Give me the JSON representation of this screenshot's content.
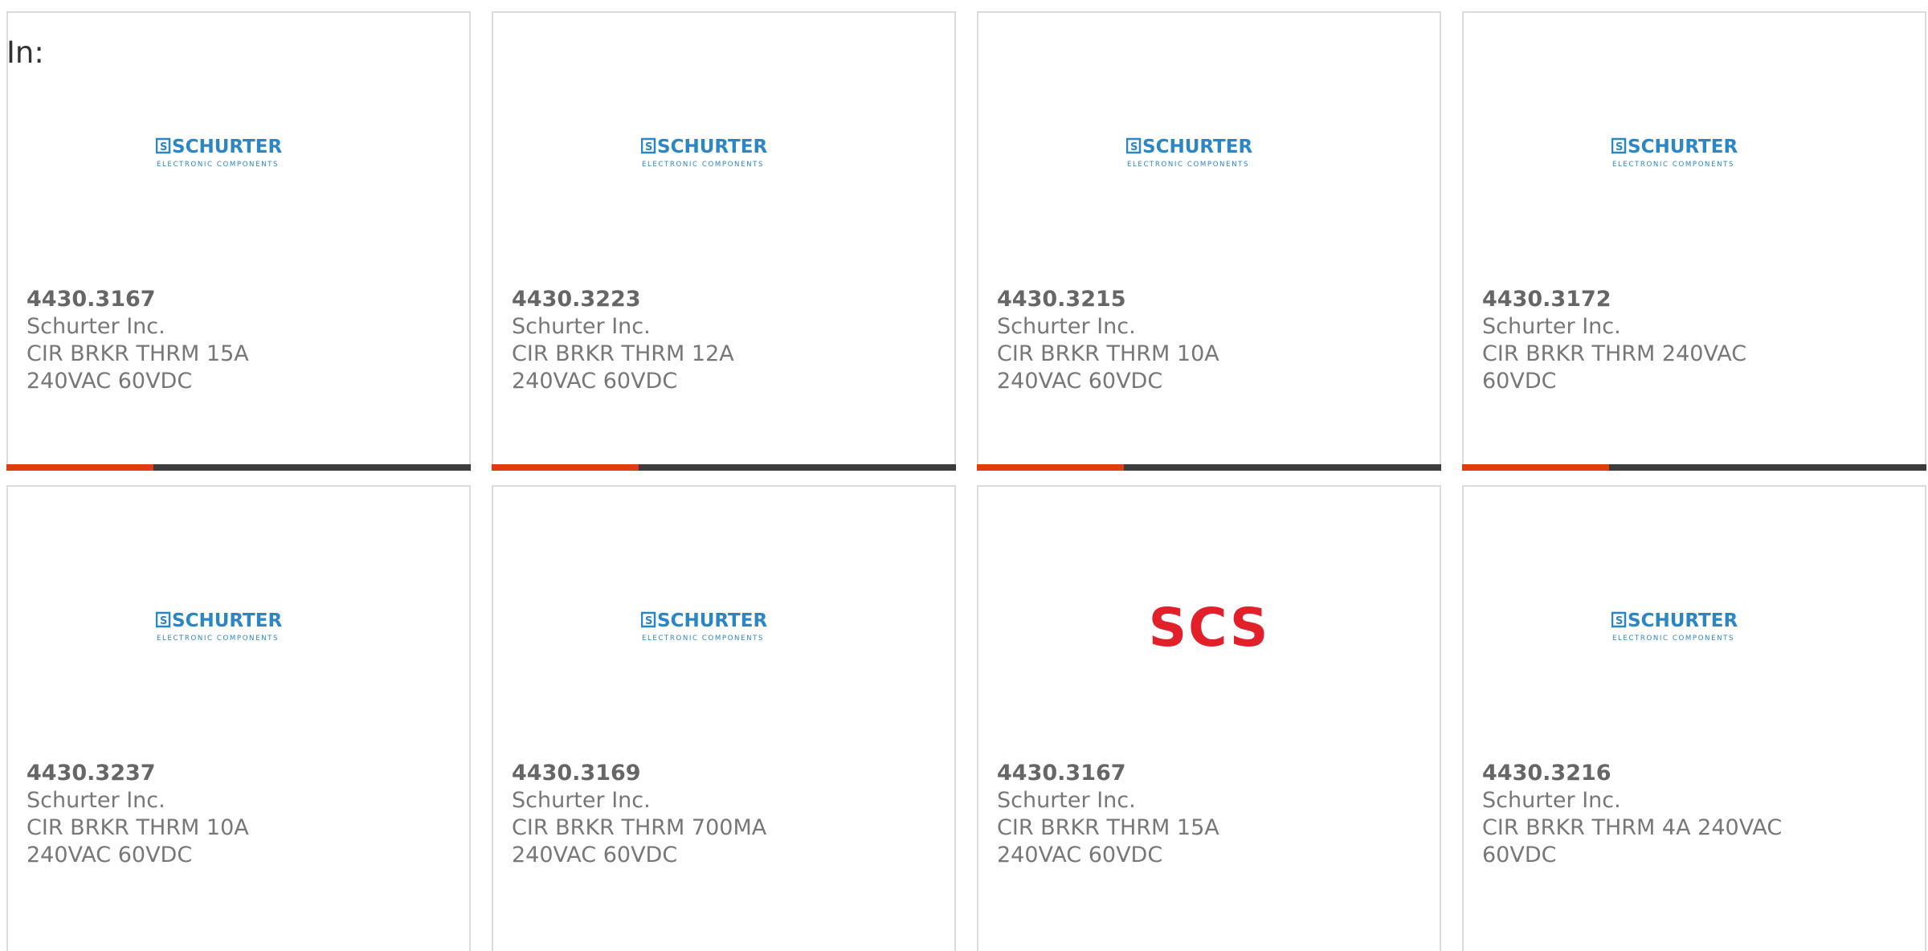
{
  "header": {
    "in_label": "In:"
  },
  "colors": {
    "accent": "#e03c10",
    "bar": "#3c3c3c",
    "schurter_blue": "#2b86c5",
    "scs_red": "#e2202a"
  },
  "products": [
    {
      "logo": "schurter",
      "brand_text": "SCHURTER",
      "brand_sub": "ELECTRONIC COMPONENTS",
      "part_number": "4430.3167",
      "manufacturer": "Schurter Inc.",
      "description": "CIR BRKR THRM 15A 240VAC 60VDC"
    },
    {
      "logo": "schurter",
      "brand_text": "SCHURTER",
      "brand_sub": "ELECTRONIC COMPONENTS",
      "part_number": "4430.3223",
      "manufacturer": "Schurter Inc.",
      "description": "CIR BRKR THRM 12A 240VAC 60VDC"
    },
    {
      "logo": "schurter",
      "brand_text": "SCHURTER",
      "brand_sub": "ELECTRONIC COMPONENTS",
      "part_number": "4430.3215",
      "manufacturer": "Schurter Inc.",
      "description": "CIR BRKR THRM 10A 240VAC 60VDC"
    },
    {
      "logo": "schurter",
      "brand_text": "SCHURTER",
      "brand_sub": "ELECTRONIC COMPONENTS",
      "part_number": "4430.3172",
      "manufacturer": "Schurter Inc.",
      "description": "CIR BRKR THRM 240VAC 60VDC"
    },
    {
      "logo": "schurter",
      "brand_text": "SCHURTER",
      "brand_sub": "ELECTRONIC COMPONENTS",
      "part_number": "4430.3237",
      "manufacturer": "Schurter Inc.",
      "description": "CIR BRKR THRM 10A 240VAC 60VDC"
    },
    {
      "logo": "schurter",
      "brand_text": "SCHURTER",
      "brand_sub": "ELECTRONIC COMPONENTS",
      "part_number": "4430.3169",
      "manufacturer": "Schurter Inc.",
      "description": "CIR BRKR THRM 700MA 240VAC 60VDC"
    },
    {
      "logo": "scs",
      "brand_text": "SCS",
      "part_number": "4430.3167",
      "manufacturer": "Schurter Inc.",
      "description": "CIR BRKR THRM 15A 240VAC 60VDC"
    },
    {
      "logo": "schurter",
      "brand_text": "SCHURTER",
      "brand_sub": "ELECTRONIC COMPONENTS",
      "part_number": "4430.3216",
      "manufacturer": "Schurter Inc.",
      "description": "CIR BRKR THRM 4A 240VAC 60VDC"
    }
  ]
}
